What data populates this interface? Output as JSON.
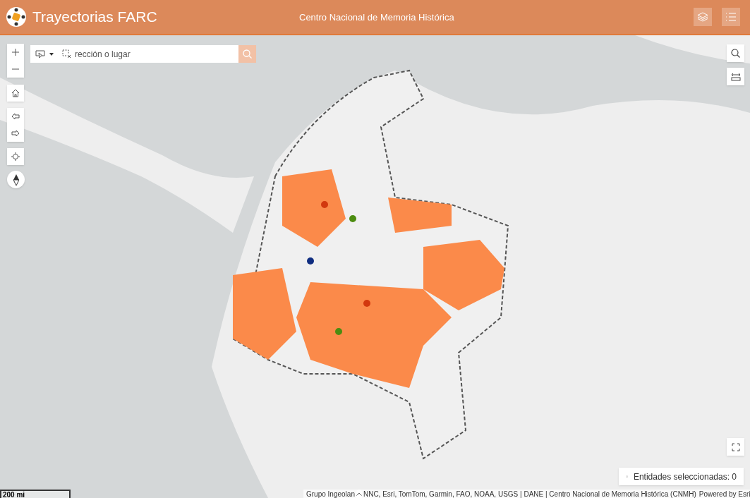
{
  "header": {
    "title": "Trayectorias FARC",
    "subtitle": "Centro Nacional de Memoria Histórica"
  },
  "search": {
    "placeholder": "rección o lugar"
  },
  "scale_bar": {
    "label": "200 mi"
  },
  "selection_status": {
    "label": "Entidades seleccionadas: 0"
  },
  "attribution": {
    "parts": [
      "Grupo Ingeolan",
      "NNC, Esri, TomTom, Garmin, FAO, NOAA, USGS | DANE | Centro Nacional de Memoria Histórica (CNMH)"
    ],
    "powered_by": "Powered by Esri"
  }
}
